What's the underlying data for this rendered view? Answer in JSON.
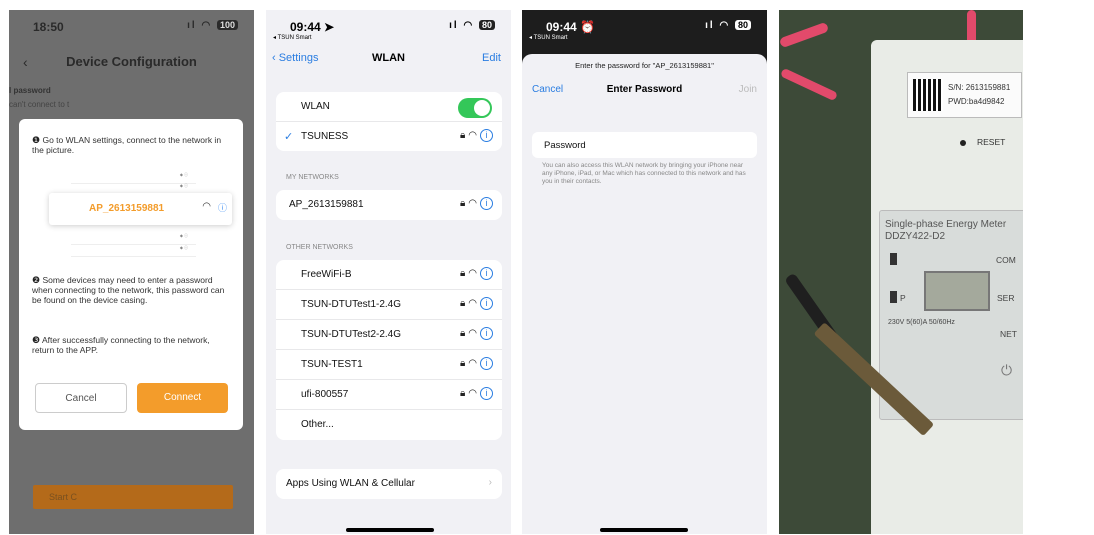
{
  "panel1": {
    "status": {
      "time": "18:50",
      "signal": "ull",
      "battery": "100"
    },
    "header": {
      "back": "‹",
      "title": "Device Configuration"
    },
    "bg_lines": [
      "l password",
      "can't connect to t"
    ],
    "dialog": {
      "step1": "Go to WLAN settings, connect to the network in the picture.",
      "network_name": "AP_2613159881",
      "step2": "Some devices may need to enter a password when connecting to the network, this password can be found on the device casing.",
      "step3": "After successfully connecting to the network, return to the APP.",
      "cancel": "Cancel",
      "connect": "Connect",
      "bullet1": "❶",
      "bullet2": "❷",
      "bullet3": "❸"
    },
    "start_button": "Start C"
  },
  "panel2": {
    "status": {
      "time": "09:44 ➤",
      "back_app": "◂ TSUN Smart",
      "battery": "80"
    },
    "nav": {
      "back": "‹ Settings",
      "title": "WLAN",
      "edit": "Edit"
    },
    "wlan_label": "WLAN",
    "connected": "TSUNESS",
    "my_networks_header": "MY NETWORKS",
    "my_networks": [
      "AP_2613159881"
    ],
    "other_networks_header": "OTHER NETWORKS",
    "other_networks": [
      "FreeWiFi-B",
      "TSUN-DTUTest1-2.4G",
      "TSUN-DTUTest2-2.4G",
      "TSUN-TEST1",
      "ufi-800557"
    ],
    "other_label": "Other...",
    "apps_row": "Apps Using WLAN & Cellular"
  },
  "panel3": {
    "status": {
      "time": "09:44 ⏰",
      "back_app": "◂ TSUN Smart",
      "battery": "80"
    },
    "prompt": "Enter the password for \"AP_2613159881\"",
    "cancel": "Cancel",
    "title": "Enter Password",
    "join": "Join",
    "field_label": "Password",
    "note": "You can also access this WLAN network by bringing your iPhone near any iPhone, iPad, or Mac which has connected to this network and has you in their contacts."
  },
  "panel4": {
    "sn": "S/N: 2613159881",
    "pwd": "PWD:ba4d9842",
    "reset": "RESET",
    "meter_title_1": "Single-phase Energy Meter",
    "meter_title_2": "DDZY422-D2",
    "com": "COM",
    "ser": "SER",
    "net": "NET",
    "p": "P",
    "spec": "230V 5(60)A 50/60Hz"
  }
}
